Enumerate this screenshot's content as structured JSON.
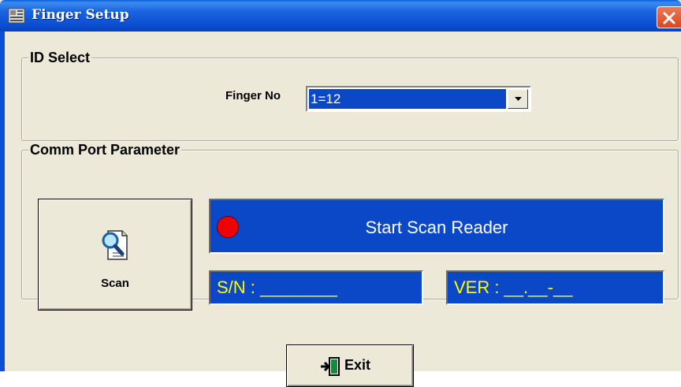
{
  "window": {
    "title": "Finger Setup",
    "close_icon": "close-x-icon"
  },
  "id_select": {
    "legend": "ID Select",
    "finger_label": "Finger No",
    "finger_value": "1=12"
  },
  "comm_port": {
    "legend": "Comm Port Parameter",
    "scan_label": "Scan",
    "status_text": "Start Scan Reader",
    "status_led_color": "#ee0000",
    "sn_text": "S/N : ________",
    "ver_text": "VER : __.__-__"
  },
  "footer": {
    "exit_label": "Exit"
  },
  "colors": {
    "panel_bg": "#0a48c8",
    "panel_yellow_text": "#ffff00"
  }
}
